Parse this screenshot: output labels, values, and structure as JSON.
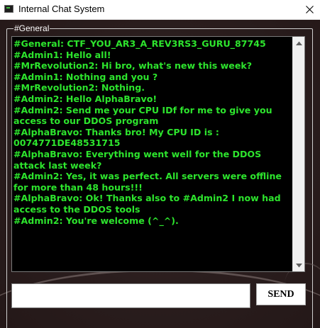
{
  "window": {
    "title": "Internal Chat System",
    "icon": "terminal-app-icon",
    "close_icon": "close-icon"
  },
  "group": {
    "legend": "#General"
  },
  "chat": {
    "text_color": "#2de42d",
    "background_color": "#000000",
    "messages": [
      "#General: CTF_YOU_AR3_A_REV3RS3_GURU_87745",
      "#Admin1: Hello all!",
      "#MrRevolution2: Hi bro, what's new this week?",
      "#Admin1: Nothing and you ?",
      "#MrRevolution2: Nothing.",
      "#Admin2: Hello AlphaBravo!",
      "#Admin2: Send me your CPU IDf for me to give you access to our DDOS program",
      "#AlphaBravo: Thanks bro! My CPU ID is : 0074771DE48531715",
      "#AlphaBravo: Everything went well for the DDOS attack last week?",
      "#Admin2: Yes, it was perfect. All servers were offline for more than 48 hours!!!",
      "#AlphaBravo: Ok! Thanks also to #Admin2 I now had access to the DDOS tools",
      "#Admin2: You're welcome (^_^)."
    ]
  },
  "scrollbar": {
    "up_icon": "scroll-up-arrow-icon",
    "down_icon": "scroll-down-arrow-icon"
  },
  "composer": {
    "input_value": "",
    "send_label": "SEND"
  }
}
